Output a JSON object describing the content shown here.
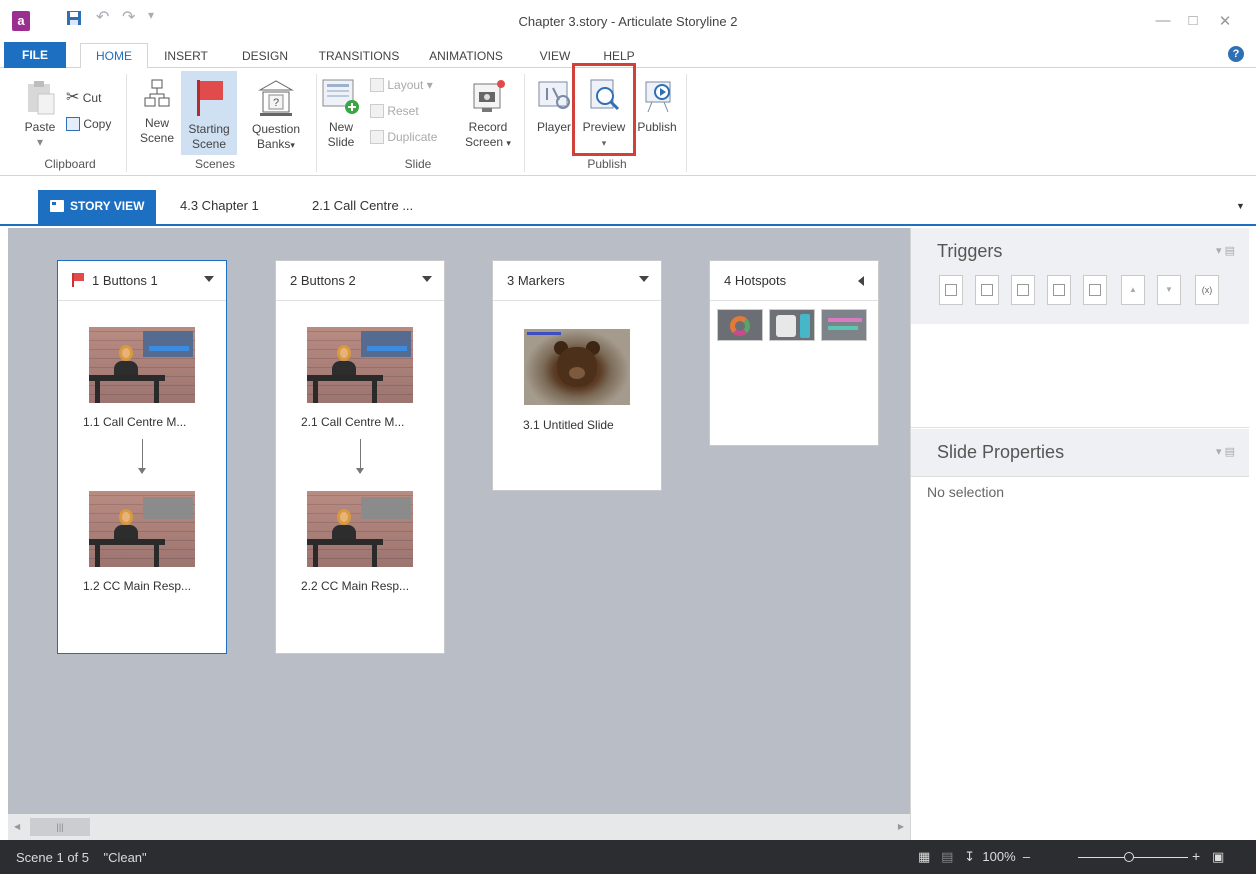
{
  "window": {
    "title": "Chapter 3.story - Articulate Storyline 2",
    "logo_letter": "a"
  },
  "ribbon_tabs": [
    {
      "label": "FILE"
    },
    {
      "label": "HOME"
    },
    {
      "label": "INSERT"
    },
    {
      "label": "DESIGN"
    },
    {
      "label": "TRANSITIONS"
    },
    {
      "label": "ANIMATIONS"
    },
    {
      "label": "VIEW"
    },
    {
      "label": "HELP"
    }
  ],
  "ribbon": {
    "clipboard": {
      "paste": "Paste",
      "cut": "Cut",
      "copy": "Copy",
      "group": "Clipboard"
    },
    "scenes": {
      "new_scene_1": "New",
      "new_scene_2": "Scene",
      "starting_1": "Starting",
      "starting_2": "Scene",
      "qbanks_1": "Question",
      "qbanks_2": "Banks",
      "group": "Scenes"
    },
    "slide": {
      "new_slide_1": "New",
      "new_slide_2": "Slide",
      "layout": "Layout",
      "reset": "Reset",
      "duplicate": "Duplicate",
      "record_1": "Record",
      "record_2": "Screen",
      "group": "Slide"
    },
    "publish": {
      "player": "Player",
      "preview": "Preview",
      "publish": "Publish",
      "group": "Publish"
    }
  },
  "story_tabs": [
    {
      "label": "STORY VIEW"
    },
    {
      "label": "4.3 Chapter 1"
    },
    {
      "label": "2.1 Call Centre ..."
    }
  ],
  "scenes": [
    {
      "title": "1 Buttons 1",
      "slides": [
        {
          "label": "1.1 Call Centre M..."
        },
        {
          "label": "1.2 CC Main Resp..."
        }
      ]
    },
    {
      "title": "2 Buttons 2",
      "slides": [
        {
          "label": "2.1 Call Centre M..."
        },
        {
          "label": "2.2 CC Main Resp..."
        }
      ]
    },
    {
      "title": "3 Markers",
      "slides": [
        {
          "label": "3.1 Untitled Slide"
        }
      ]
    },
    {
      "title": "4 Hotspots"
    }
  ],
  "panels": {
    "triggers": {
      "title": "Triggers"
    },
    "slide_properties": {
      "title": "Slide Properties",
      "empty_text": "No selection"
    }
  },
  "status": {
    "scene_info": "Scene 1 of 5",
    "theme": "\"Clean\"",
    "zoom": "100%"
  },
  "colors": {
    "accent": "#1c6fc1",
    "highlight_box": "#d2403a",
    "canvas_bg": "#b9bec6",
    "statusbar_bg": "#2b2d30"
  },
  "icons": [
    "app-logo-icon",
    "save-icon",
    "undo-icon",
    "redo-icon",
    "customize-qat-icon",
    "minimize-icon",
    "maximize-icon",
    "close-icon",
    "help-icon",
    "paste-icon",
    "cut-icon",
    "copy-icon",
    "new-scene-icon",
    "starting-scene-flag-icon",
    "question-banks-icon",
    "new-slide-icon",
    "layout-icon",
    "reset-icon",
    "duplicate-icon",
    "record-screen-icon",
    "player-icon",
    "preview-icon",
    "publish-icon",
    "story-view-icon",
    "flag-icon",
    "new-trigger-icon",
    "edit-trigger-icon",
    "copy-trigger-icon",
    "paste-trigger-icon",
    "delete-trigger-icon",
    "move-up-icon",
    "move-down-icon",
    "variables-icon"
  ]
}
